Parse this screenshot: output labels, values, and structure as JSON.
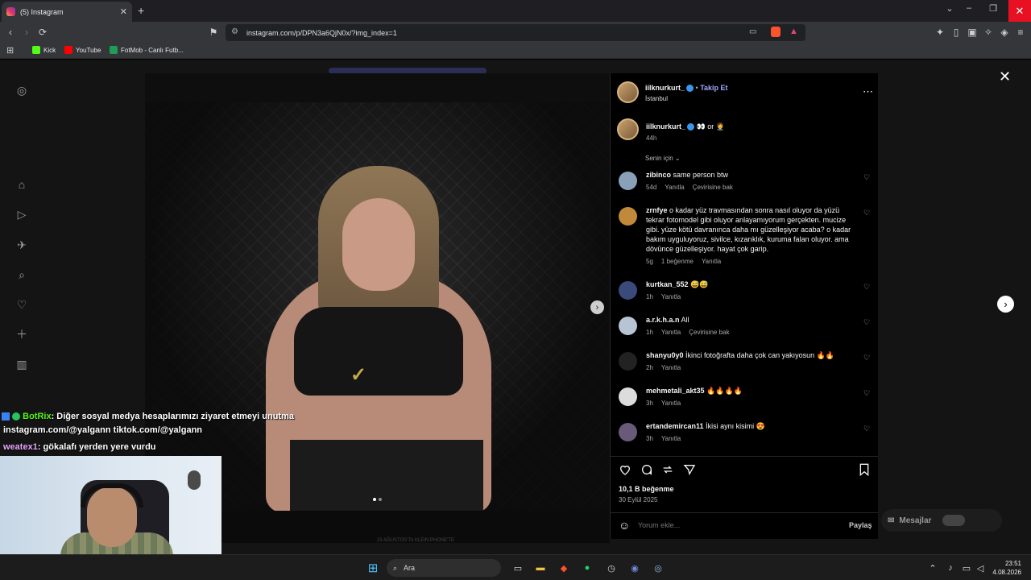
{
  "browser": {
    "tab_title": "(5) Instagram",
    "new_tab": "+",
    "url": "instagram.com/p/DPN3a6QjN0x/?img_index=1",
    "bookmarks": [
      {
        "label": "Kick",
        "color": "#53fc18"
      },
      {
        "label": "YouTube",
        "color": "#ff0000"
      },
      {
        "label": "FotMob - Canlı Futb...",
        "color": "#1f9d55"
      }
    ],
    "window_controls": [
      "⌄",
      "–",
      "❐",
      "✕"
    ]
  },
  "post": {
    "author": "iilknurkurt_",
    "follow_label": "Takip Et",
    "location": "İstanbul",
    "caption_suffix": "👀 or 🤵",
    "caption_time": "44h",
    "sort_label": "Senin için ⌄",
    "comments": [
      {
        "user": "zibinco",
        "text": "same person btw",
        "meta": [
          "54d",
          "Yanıtla",
          "Çevirisine bak"
        ],
        "avatar": "#8aa0b8"
      },
      {
        "user": "zrnfye",
        "text": "o kadar yüz travmasından sonra nasıl oluyor da yüzü tekrar fotomodel gibi oluyor anlayamıyorum gerçekten. mucize gibi. yüze kötü davranınca daha mı güzelleşiyor acaba? o kadar bakım uyguluyoruz, sivilce, kızarıklık, kuruma falan oluyor. ama dövünce güzelleşiyor. hayat çok garip.",
        "meta": [
          "5g",
          "1 beğenme",
          "Yanıtla"
        ],
        "avatar": "#c08a3a"
      },
      {
        "user": "kurtkan_552",
        "text": "😅😅",
        "meta": [
          "1h",
          "Yanıtla"
        ],
        "avatar": "#3a4a7a"
      },
      {
        "user": "a.r.k.h.a.n",
        "text": "All",
        "meta": [
          "1h",
          "Yanıtla",
          "Çevirisine bak"
        ],
        "avatar": "#b7c4d4"
      },
      {
        "user": "shanyu0y0",
        "text": "İkinci fotoğrafta daha çok can yakıyosun 🔥🔥",
        "meta": [
          "2h",
          "Yanıtla"
        ],
        "avatar": "#222222"
      },
      {
        "user": "mehmetali_akt35",
        "text": "🔥🔥🔥🔥",
        "meta": [
          "3h",
          "Yanıtla"
        ],
        "avatar": "#dcdcdc"
      },
      {
        "user": "ertandemircan11",
        "text": "İkisi aynı kisimi 😍",
        "meta": [
          "3h",
          "Yanıtla"
        ],
        "avatar": "#6a5a7a"
      }
    ],
    "likes": "10,1 B beğenme",
    "date": "30 Eylül 2025",
    "comment_placeholder": "Yorum ekle...",
    "share_label": "Paylaş",
    "image_caption_strip": "23 AĞUSTOS'TA KLEIN PHONE'TE"
  },
  "messages_label": "Mesajlar",
  "stream_chat": {
    "line1_user": "BotRix",
    "line1_text": ": Diğer sosyal medya hesaplarımızı ziyaret etmeyi unutma",
    "line2": "instagram.com/@yalgann tiktok.com/@yalgann",
    "line3_user": "weatex1",
    "line3_text": ": gökalafı yerden yere vurdu"
  },
  "taskbar": {
    "search": "Ara",
    "time": "23:51",
    "date": "4.08.2026"
  },
  "colors": {
    "accent_blue": "#3897f0",
    "follow": "#a3a7ff",
    "close_red": "#e81123"
  }
}
